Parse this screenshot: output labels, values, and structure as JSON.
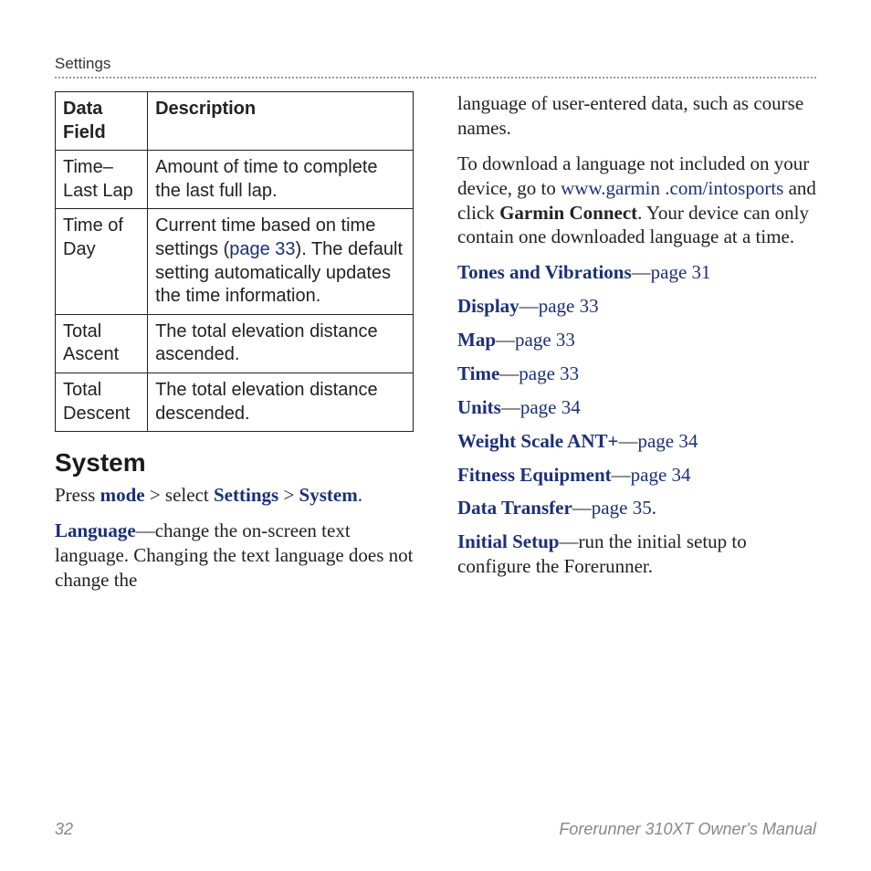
{
  "header": {
    "section": "Settings"
  },
  "table": {
    "headers": [
      "Data Field",
      "Description"
    ],
    "rows": [
      {
        "field": "Time–Last Lap",
        "desc_pre": "Amount of time to complete the last full lap.",
        "link": "",
        "desc_post": ""
      },
      {
        "field": "Time of Day",
        "desc_pre": "Current time based on time settings (",
        "link": "page 33",
        "desc_post": "). The default setting automatically updates the time information."
      },
      {
        "field": "Total Ascent",
        "desc_pre": "The total elevation distance ascended.",
        "link": "",
        "desc_post": ""
      },
      {
        "field": "Total Descent",
        "desc_pre": "The total elevation distance descended.",
        "link": "",
        "desc_post": ""
      }
    ]
  },
  "system": {
    "heading": "System",
    "press": "Press ",
    "mode": "mode",
    "gt1": " > select ",
    "settings": "Settings",
    "gt2": " > ",
    "system_word": "System",
    "period": "."
  },
  "language": {
    "label": "Language",
    "dash": "—",
    "text1": "change the on-screen text language. Changing the text language does not change the",
    "text2": "language of user-entered data, such as course names."
  },
  "download": {
    "pre": "To download a language not included on your device, go to ",
    "url": "www.garmin .com/intosports",
    "mid": " and click ",
    "connect": "Garmin Connect",
    "post": ". Your device can only contain one downloaded language at a time."
  },
  "toc": [
    {
      "label": "Tones and Vibrations",
      "dash": "—",
      "link": "page 31",
      "suffix": ""
    },
    {
      "label": "Display",
      "dash": "—",
      "link": "page 33",
      "suffix": ""
    },
    {
      "label": "Map",
      "dash": "—",
      "link": "page 33",
      "suffix": ""
    },
    {
      "label": "Time",
      "dash": "—",
      "link": "page 33",
      "suffix": ""
    },
    {
      "label": "Units",
      "dash": "—",
      "link": "page 34",
      "suffix": ""
    },
    {
      "label": "Weight Scale ANT+",
      "dash": "—",
      "link": "page 34",
      "suffix": ""
    },
    {
      "label": "Fitness Equipment",
      "dash": "—",
      "link": "page 34",
      "suffix": ""
    },
    {
      "label": "Data Transfer",
      "dash": "—",
      "link": "page 35",
      "suffix": "."
    }
  ],
  "initial": {
    "label": "Initial Setup",
    "dash": "—",
    "text": "run the initial setup to configure the Forerunner."
  },
  "footer": {
    "page": "32",
    "manual": "Forerunner 310XT Owner's Manual"
  }
}
